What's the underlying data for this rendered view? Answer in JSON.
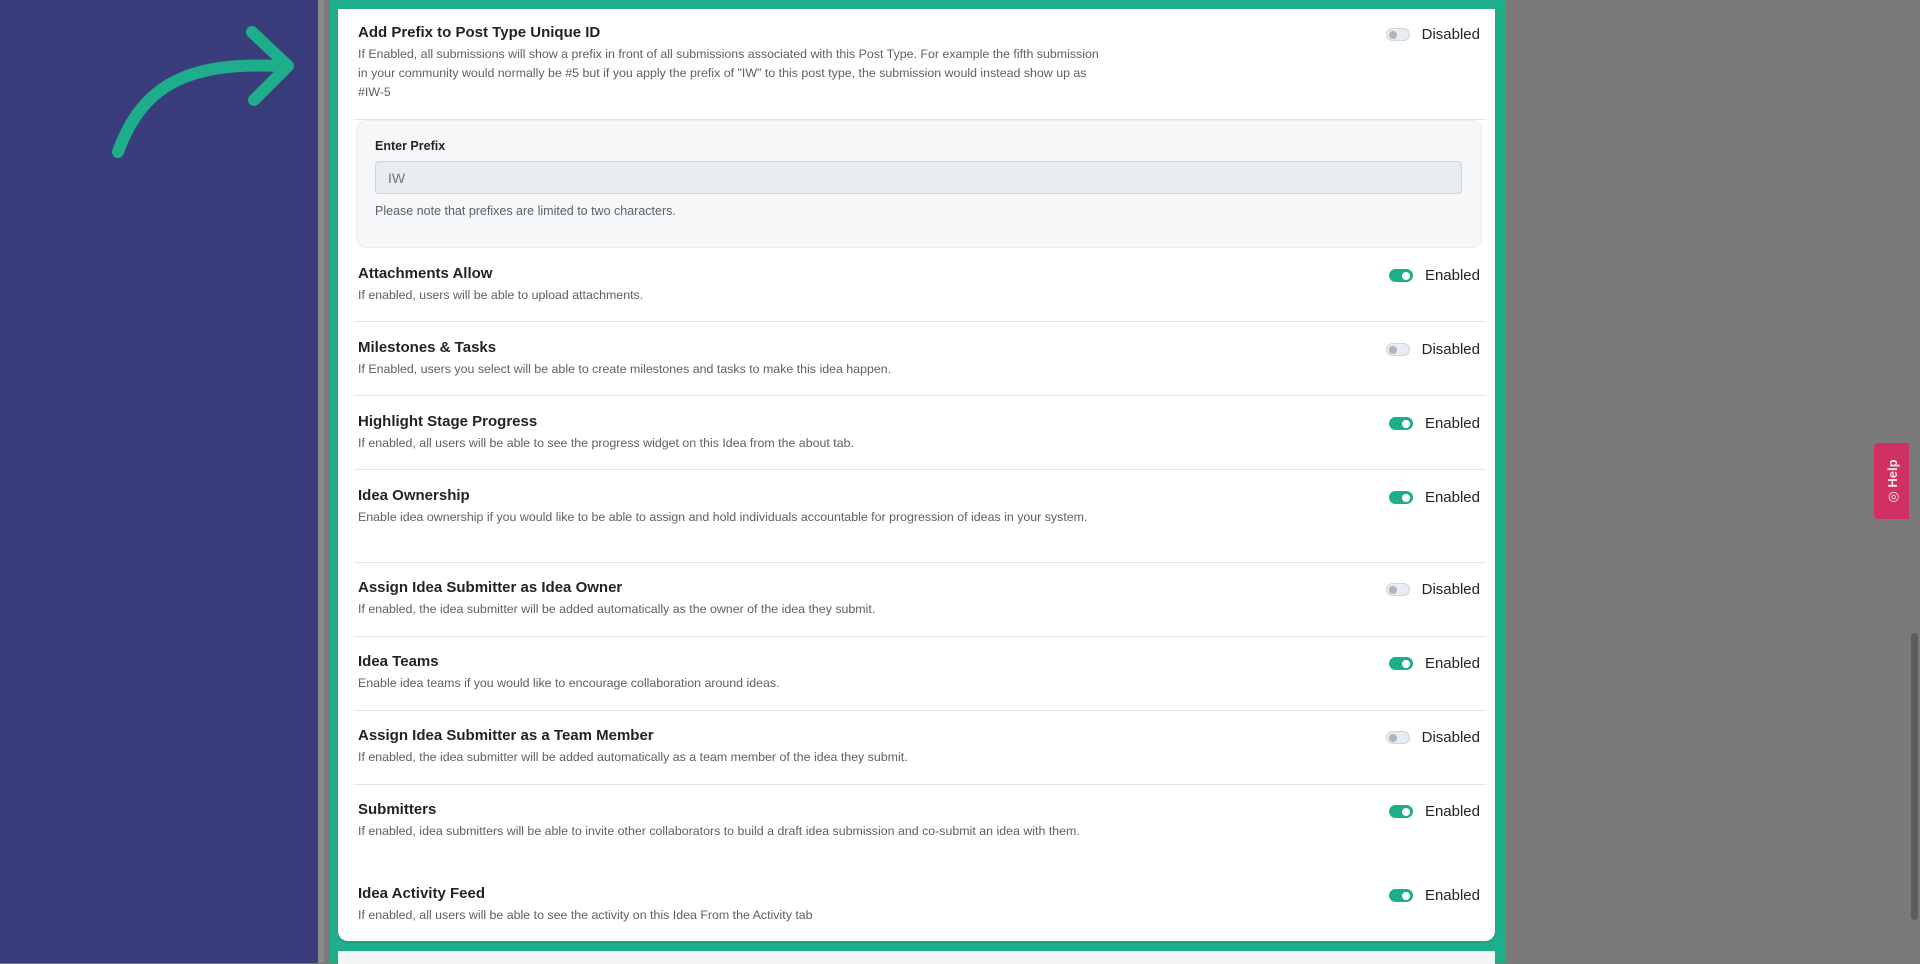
{
  "prefix_setting": {
    "title": "Add Prefix to Post Type Unique ID",
    "description": "If Enabled, all submissions will show a prefix in front of all submissions associated with this Post Type. For example the fifth submission in your community would normally be #5 but if you apply the prefix of \"IW\" to this post type, the submission would instead show up as #IW-5",
    "status": "Disabled",
    "enabled": false,
    "input_label": "Enter Prefix",
    "input_placeholder": "IW",
    "note": "Please note that prefixes are limited to two characters."
  },
  "settings": [
    {
      "title": "Attachments Allow",
      "description": "If enabled, users will be able to upload attachments.",
      "status": "Enabled",
      "enabled": true
    },
    {
      "title": "Milestones & Tasks",
      "description": "If Enabled, users you select will be able to create milestones and tasks to make this idea happen.",
      "status": "Disabled",
      "enabled": false
    },
    {
      "title": "Highlight Stage Progress",
      "description": "If enabled, all users will be able to see the progress widget on this Idea from the about tab.",
      "status": "Enabled",
      "enabled": true
    },
    {
      "title": "Idea Ownership",
      "description": "Enable idea ownership if you would like to be able to assign and hold individuals accountable for progression of ideas in your system.",
      "status": "Enabled",
      "enabled": true
    },
    {
      "title": "Assign Idea Submitter as Idea Owner",
      "description": "If enabled, the idea submitter will be added automatically as the owner of the idea they submit.",
      "status": "Disabled",
      "enabled": false
    },
    {
      "title": "Idea Teams",
      "description": "Enable idea teams if you would like to encourage collaboration around ideas.",
      "status": "Enabled",
      "enabled": true
    },
    {
      "title": "Assign Idea Submitter as a Team Member",
      "description": "If enabled, the idea submitter will be added automatically as a team member of the idea they submit.",
      "status": "Disabled",
      "enabled": false
    },
    {
      "title": "Submitters",
      "description": "If enabled, idea submitters will be able to invite other collaborators to build a draft idea submission and co-submit an idea with them.",
      "status": "Enabled",
      "enabled": true
    },
    {
      "title": "Idea Activity Feed",
      "description": "If enabled, all users will be able to see the activity on this Idea From the Activity tab",
      "status": "Enabled",
      "enabled": true
    }
  ],
  "help_tab": {
    "label": "Help",
    "icon": "lifebuoy-icon"
  },
  "colors": {
    "accent": "#1fae8c",
    "sidebar": "#3a3d7c",
    "help": "#e0245e"
  }
}
